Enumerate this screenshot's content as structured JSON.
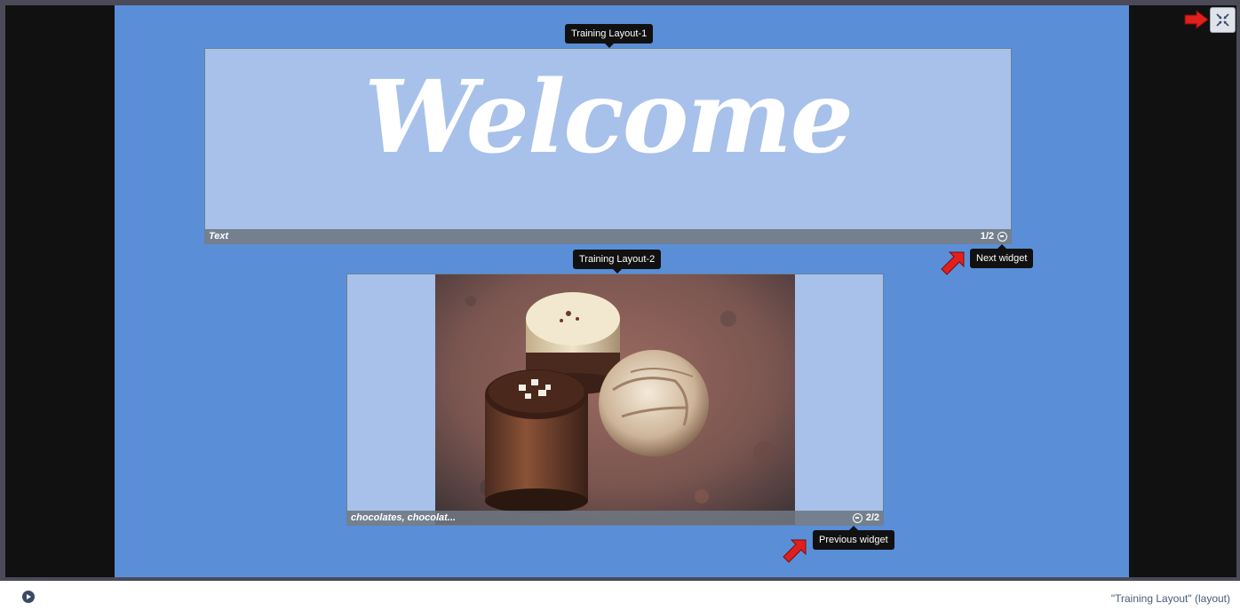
{
  "layout_tooltip_1": "Training Layout-1",
  "layout_tooltip_2": "Training Layout-2",
  "widget_text": {
    "content": "Welcome",
    "footer_label": "Text",
    "counter": "1/2"
  },
  "widget_image": {
    "footer_label": "chocolates, chocolat...",
    "counter": "2/2"
  },
  "tooltips": {
    "next": "Next widget",
    "previous": "Previous widget"
  },
  "status": {
    "label": "\"Training Layout\" (layout)"
  },
  "colors": {
    "stage_blue": "#5a8fd8",
    "widget_bg": "#a7c1ea",
    "arrow_red": "#e0201c"
  },
  "icons": {
    "exit_fullscreen": "collapse-arrows-icon",
    "play": "play-icon",
    "next": "next-circle-icon",
    "previous": "previous-circle-icon"
  }
}
